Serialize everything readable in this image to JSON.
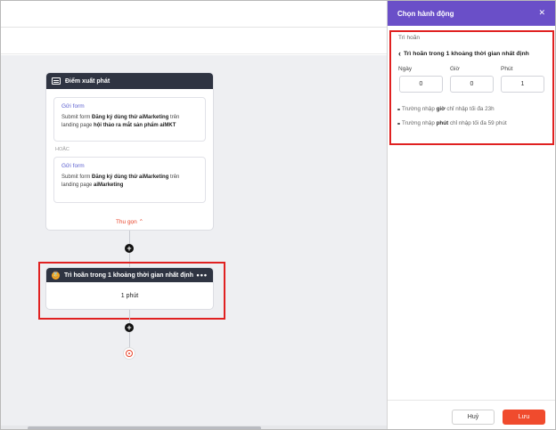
{
  "flow": {
    "start_node": {
      "title": "Điểm xuất phát",
      "triggers": [
        {
          "title": "Gửi form",
          "desc_prefix": "Submit form ",
          "form_name": "Đăng ký dùng thử aiMarketing",
          "desc_middle": " trên landing page ",
          "page_name": "hội thảo ra mắt sản phẩm aiMKT"
        },
        {
          "title": "Gửi form",
          "desc_prefix": "Submit form ",
          "form_name": "Đăng ký dùng thử aiMarketing",
          "desc_middle": " trên landing page ",
          "page_name": "aiMarketing"
        }
      ],
      "or_label": "HOẶC",
      "collapse_label": "Thu gọn ⌃"
    },
    "add_step_symbol": "+",
    "delay_node": {
      "badge": "⌛",
      "title": "Trì hoãn trong 1 khoảng thời gian nhất định",
      "more_symbol": "•••",
      "value": "1 phút"
    }
  },
  "panel": {
    "title": "Chọn hành động",
    "close_symbol": "✕",
    "breadcrumb": "Trì hoãn",
    "back_symbol": "‹",
    "subtitle": "Trì hoãn trong 1 khoảng thời gian nhất định",
    "fields": [
      {
        "label": "Ngày",
        "value": "0"
      },
      {
        "label": "Giờ",
        "value": "0"
      },
      {
        "label": "Phút",
        "value": "1"
      }
    ],
    "notes": [
      {
        "prefix": "Trường nhập ",
        "bold": "giờ",
        "suffix": " chỉ nhập tối đa 23h"
      },
      {
        "prefix": "Trường nhập ",
        "bold": "phút",
        "suffix": " chỉ nhập tối đa 59 phút"
      }
    ],
    "cancel_label": "Huỷ",
    "save_label": "Lưu"
  },
  "icons": {
    "start": "form-icon",
    "delay": "hourglass-icon",
    "end": "target-icon",
    "close": "close-icon",
    "back": "chevron-left-icon"
  },
  "colors": {
    "panel_header": "#6a4fc8",
    "node_header": "#2f3442",
    "accent_red": "#f04b2d",
    "link_purple": "#5b5fcf",
    "highlight_border": "#e02121"
  }
}
